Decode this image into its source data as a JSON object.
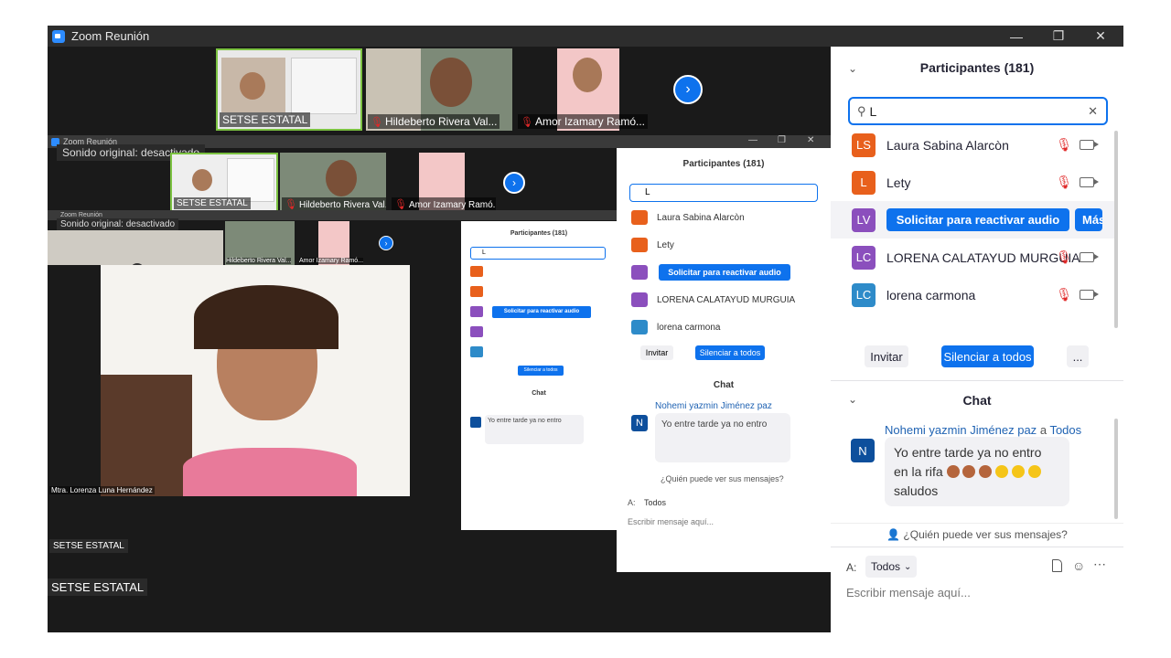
{
  "window": {
    "title": "Zoom Reunión",
    "minimize": "—",
    "restore": "❐",
    "close": "✕"
  },
  "thumbnails": [
    {
      "label": "SETSE ESTATAL",
      "muted": false
    },
    {
      "label": "Hildeberto Rivera Val...",
      "muted": true
    },
    {
      "label": "Amor  Izamary Ramó...",
      "muted": true
    }
  ],
  "nested": {
    "title": "Zoom Reunión",
    "tooltip": "Sonido original: desactivado",
    "bottom_label": "SETSE ESTATAL",
    "inner_video_label": "Mtra. Lorenza Luna Hernández",
    "panel_title": "Participantes (181)"
  },
  "video_labels": {
    "setse_small": "SETSE ESTATAL",
    "setse_large": "SETSE ESTATAL"
  },
  "participants_panel": {
    "title": "Participantes (181)",
    "search_value": "L",
    "participants": [
      {
        "initials": "LS",
        "name": "Laura Sabina Alarcòn",
        "color": "#e8601c"
      },
      {
        "initials": "L",
        "name": "Lety",
        "color": "#e8601c"
      },
      {
        "initials": "LV",
        "name": "",
        "color": "#8b4fbd",
        "action": "Solicitar para reactivar audio",
        "more": "Más"
      },
      {
        "initials": "LC",
        "name": "LORENA CALATAYUD MURGUIA",
        "color": "#8b4fbd"
      },
      {
        "initials": "LC",
        "name": "lorena carmona",
        "color": "#2e8bc9"
      }
    ],
    "invite_label": "Invitar",
    "mute_all_label": "Silenciar a todos",
    "more_label": "..."
  },
  "chat_panel": {
    "title": "Chat",
    "sender": "Nohemi yazmin Jiménez paz",
    "to_word": "a",
    "recipient": "Todos",
    "avatar_initial": "N",
    "message_line1": "Yo entre tarde ya no entro",
    "message_line2": "en la rifa",
    "message_line3": "saludos",
    "who_can_see": "¿Quién puede ver sus mensajes?",
    "to_label": "A:",
    "to_select": "Todos",
    "placeholder": "Escribir mensaje aquí..."
  },
  "colors": {
    "accent": "#0e72ed",
    "muted_red": "#e02828",
    "link": "#2063b3"
  },
  "icons": [
    "zoom-logo-icon",
    "search-icon",
    "clear-icon",
    "mic-off-icon",
    "camera-icon",
    "chevron-right-icon",
    "chevron-down-icon",
    "file-icon",
    "emoji-icon",
    "more-icon",
    "people-icon"
  ]
}
